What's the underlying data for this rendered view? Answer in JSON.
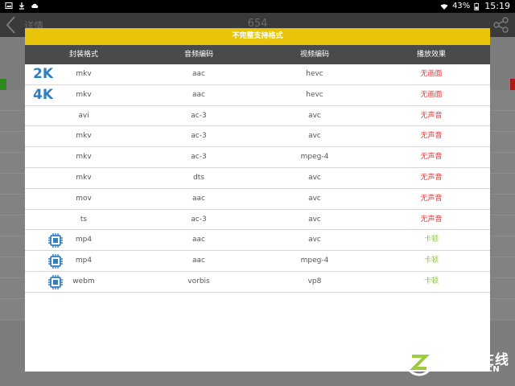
{
  "status_bar": {
    "battery": "43%",
    "time": "15:19"
  },
  "app": {
    "back_title": "详情",
    "center_title": "654"
  },
  "dialog": {
    "title": "不完整支持格式",
    "columns": [
      "封装格式",
      "音频编码",
      "视频编码",
      "播放效果"
    ],
    "rows": [
      {
        "icon": "2K",
        "container": "mkv",
        "audio": "aac",
        "video": "hevc",
        "result": "无画面",
        "result_color": "red"
      },
      {
        "icon": "4K",
        "container": "mkv",
        "audio": "aac",
        "video": "hevc",
        "result": "无画面",
        "result_color": "red"
      },
      {
        "icon": "",
        "container": "avi",
        "audio": "ac-3",
        "video": "avc",
        "result": "无声音",
        "result_color": "red"
      },
      {
        "icon": "",
        "container": "mkv",
        "audio": "ac-3",
        "video": "avc",
        "result": "无声音",
        "result_color": "red"
      },
      {
        "icon": "",
        "container": "mkv",
        "audio": "ac-3",
        "video": "mpeg-4",
        "result": "无声音",
        "result_color": "red"
      },
      {
        "icon": "",
        "container": "mkv",
        "audio": "dts",
        "video": "avc",
        "result": "无声音",
        "result_color": "red"
      },
      {
        "icon": "",
        "container": "mov",
        "audio": "aac",
        "video": "avc",
        "result": "无声音",
        "result_color": "red"
      },
      {
        "icon": "",
        "container": "ts",
        "audio": "ac-3",
        "video": "avc",
        "result": "无声音",
        "result_color": "red"
      },
      {
        "icon": "chip",
        "container": "mp4",
        "audio": "aac",
        "video": "avc",
        "result": "卡顿",
        "result_color": "green"
      },
      {
        "icon": "chip",
        "container": "mp4",
        "audio": "aac",
        "video": "mpeg-4",
        "result": "卡顿",
        "result_color": "green"
      },
      {
        "icon": "chip",
        "container": "webm",
        "audio": "vorbis",
        "video": "vp8",
        "result": "卡顿",
        "result_color": "green"
      }
    ]
  },
  "colors": {
    "accent_yellow": "#e8c50a",
    "header_dark": "#4a4a4a",
    "error_red": "#e23a3a",
    "lag_green": "#8cc63f",
    "icon_blue": "#2f7fc4"
  },
  "watermark": {
    "cn": "中关村在线",
    "en": "ZOL.COM.CN"
  }
}
